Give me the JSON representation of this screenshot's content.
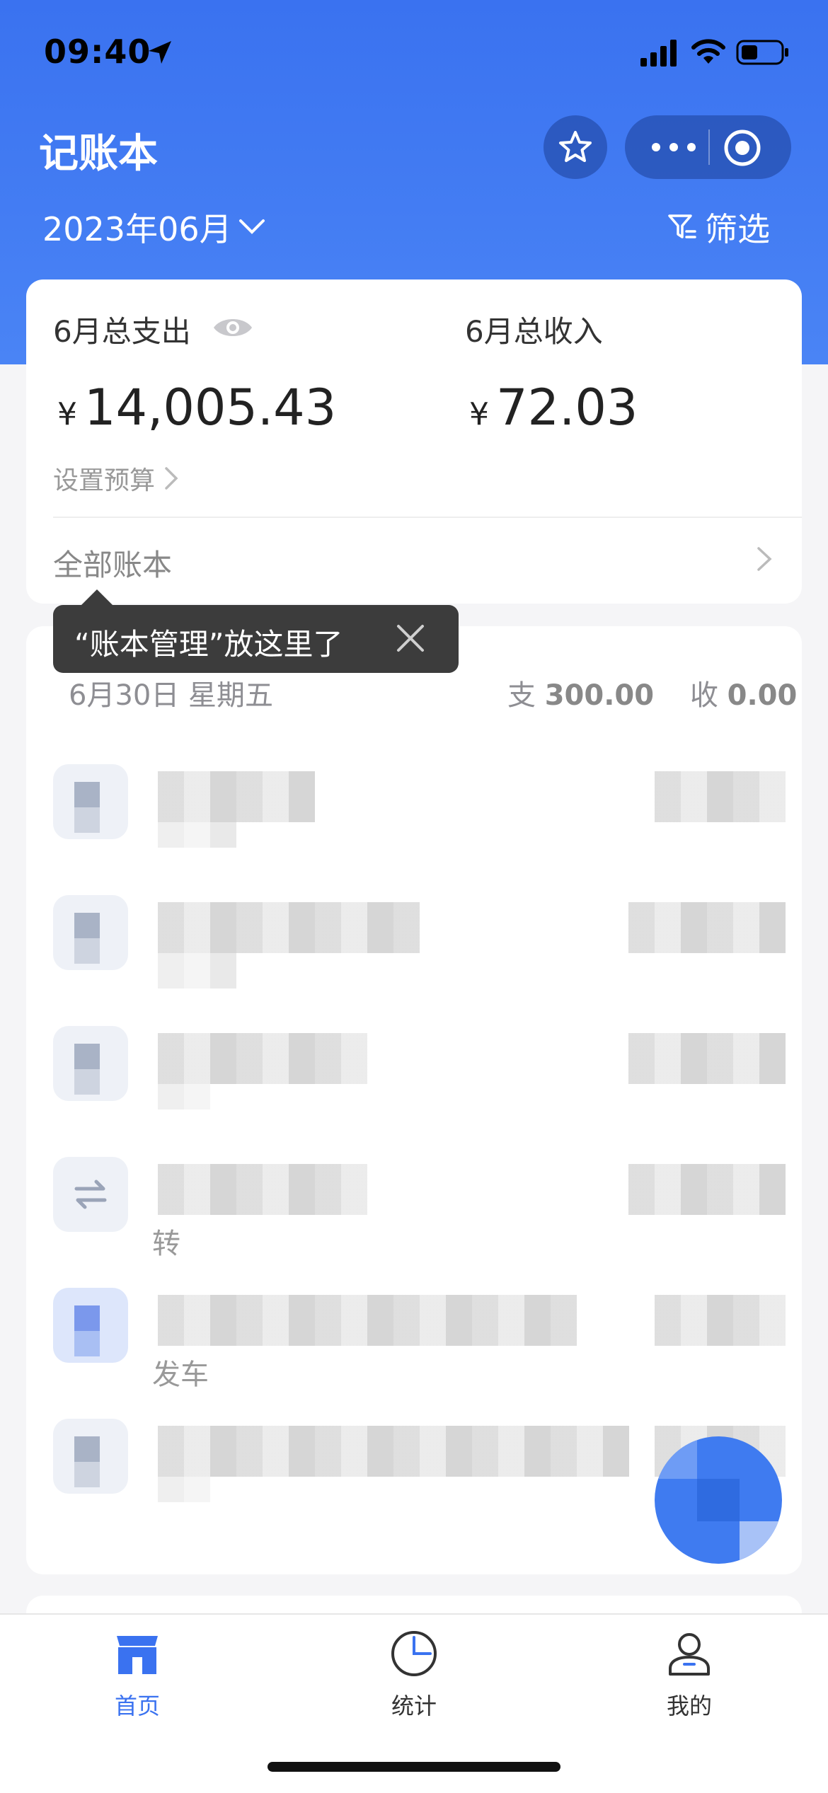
{
  "status_bar": {
    "time": "09:40"
  },
  "header": {
    "title": "记账本",
    "month": "2023年06月",
    "filter_label": "筛选"
  },
  "summary": {
    "expense_label": "6月总支出",
    "income_label": "6月总收入",
    "currency": "¥",
    "expense_amount": "14,005.43",
    "income_amount": "72.03",
    "budget_label": "设置预算",
    "all_books_label": "全部账本"
  },
  "tooltip": {
    "text": "“账本管理”放这里了"
  },
  "day_group": {
    "date": "6月30日  星期五",
    "expense_prefix": "支",
    "expense_total": "300.00",
    "income_prefix": "收",
    "income_total": "0.00"
  },
  "transactions": [
    {
      "sub": ""
    },
    {
      "sub": ""
    },
    {
      "sub": ""
    },
    {
      "sub": "转"
    },
    {
      "sub": "发车"
    },
    {
      "sub": ""
    }
  ],
  "tabbar": {
    "items": [
      {
        "label": "首页",
        "active": true
      },
      {
        "label": "统计",
        "active": false
      },
      {
        "label": "我的",
        "active": false
      }
    ]
  },
  "colors": {
    "primary": "#3a72f0",
    "background": "#f5f5f7"
  },
  "icons": [
    "location-arrow-icon",
    "cellular-signal-icon",
    "wifi-icon",
    "battery-icon",
    "star-icon",
    "more-icon",
    "target-icon",
    "chevron-down-icon",
    "filter-icon",
    "eye-icon",
    "chevron-right-icon",
    "close-icon",
    "transfer-icon",
    "home-icon",
    "stats-icon",
    "profile-icon"
  ]
}
